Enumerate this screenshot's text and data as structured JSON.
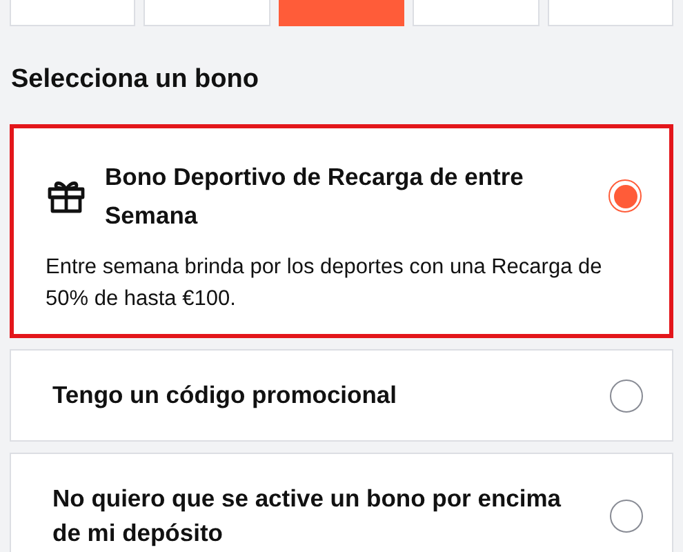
{
  "amounts": [
    {
      "selected": false
    },
    {
      "selected": false
    },
    {
      "selected": true
    },
    {
      "selected": false
    },
    {
      "selected": false
    }
  ],
  "heading": "Selecciona un bono",
  "bonuses": [
    {
      "kind": "gift",
      "title": "Bono Deportivo de Recarga de entre Semana",
      "description": "Entre semana brinda por los deportes con una Recarga de 50% de hasta €100.",
      "selected": true
    },
    {
      "kind": "plain",
      "title": "Tengo un código promocional",
      "selected": false
    },
    {
      "kind": "plain",
      "title": "No quiero que se active un bono por encima de mi depósito",
      "selected": false
    }
  ]
}
